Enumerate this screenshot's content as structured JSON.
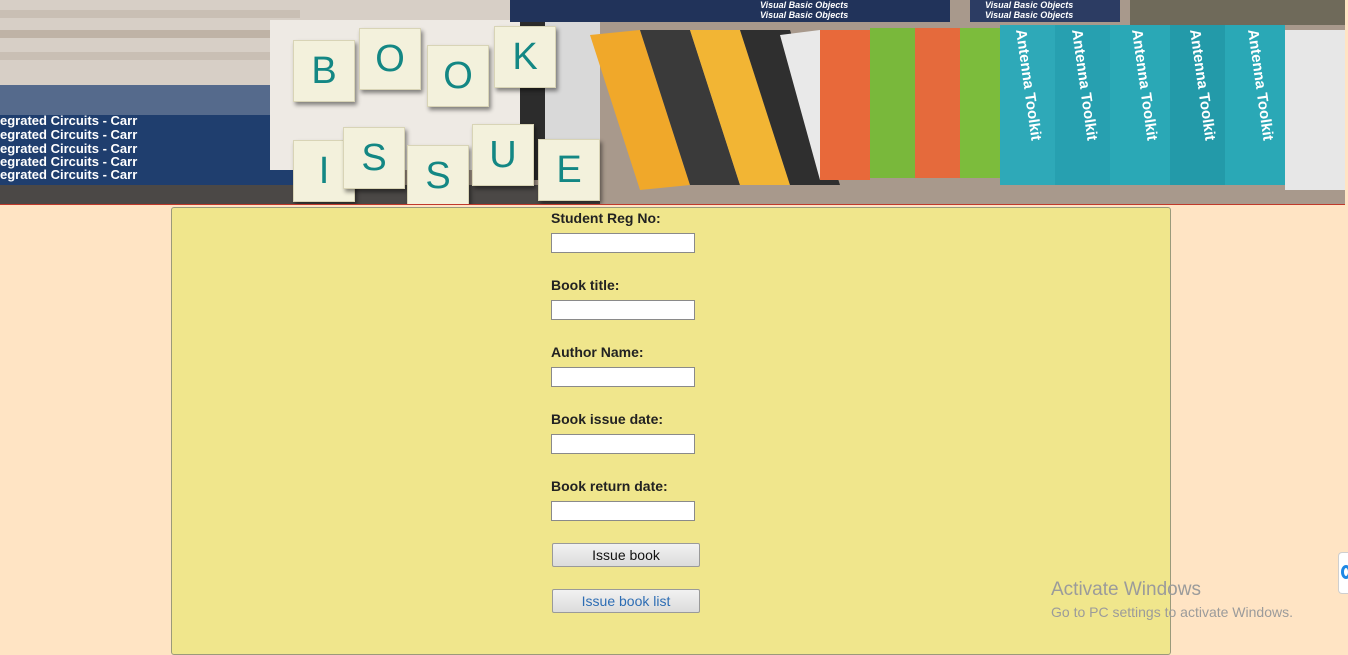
{
  "banner": {
    "title_letters_top": [
      "B",
      "O",
      "O",
      "K"
    ],
    "title_letters_bottom": [
      "I",
      "S",
      "S",
      "U",
      "E"
    ],
    "spine_labels": {
      "integrated": "egrated Circuits - Carr",
      "visual_basic": "Visual Basic Objects",
      "antenna": "Antenna Toolkit"
    },
    "colors": {
      "tile": "#f3f1dc",
      "tile_letter": "#138784"
    }
  },
  "form": {
    "background": "#f0e68c",
    "fields": [
      {
        "label": "Student Reg No:",
        "value": "",
        "placeholder": ""
      },
      {
        "label": "Book title:",
        "value": "",
        "placeholder": ""
      },
      {
        "label": "Author Name:",
        "value": "",
        "placeholder": ""
      },
      {
        "label": "Book issue date:",
        "value": "",
        "placeholder": ""
      },
      {
        "label": "Book return date:",
        "value": "",
        "placeholder": ""
      }
    ],
    "issue_button_label": "Issue book",
    "list_button_label": "Issue book list"
  },
  "watermark": {
    "title": "Activate Windows",
    "subtitle": "Go to PC settings to activate Windows."
  },
  "page_background": "#ffe4c4"
}
